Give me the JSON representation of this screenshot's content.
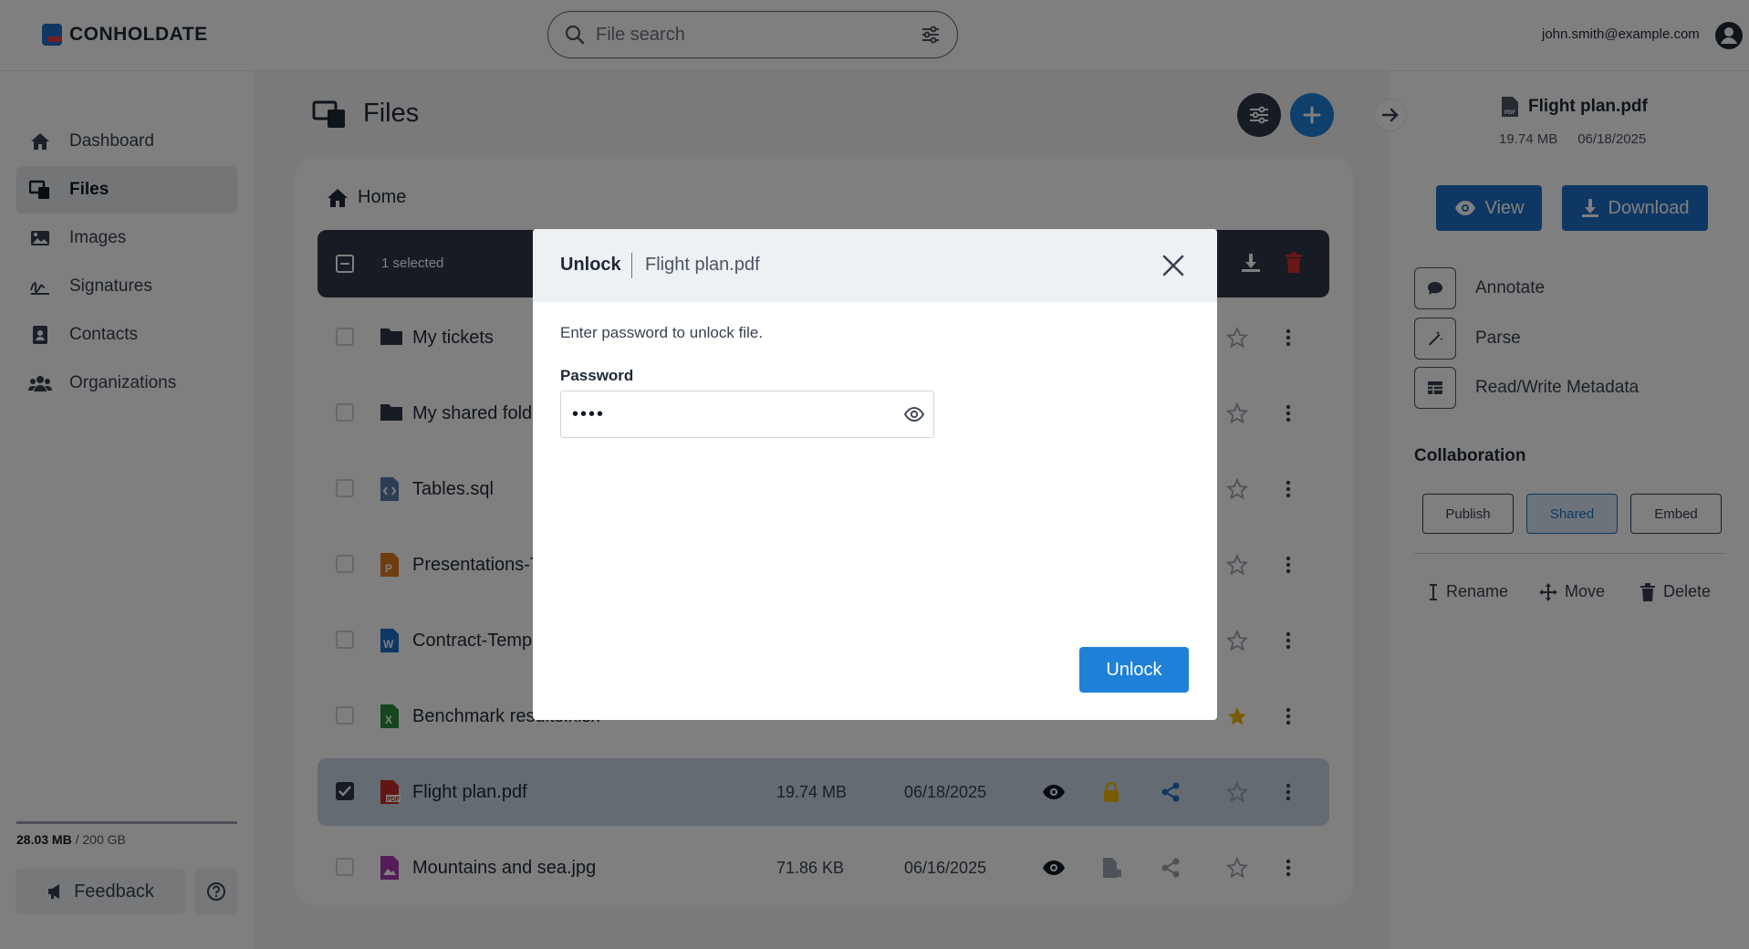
{
  "brand": {
    "name": "CONHOLDATE"
  },
  "header": {
    "search_placeholder": "File search",
    "user_email": "john.smith@example.com"
  },
  "sidebar": {
    "items": [
      {
        "label": "Dashboard",
        "icon": "home-icon"
      },
      {
        "label": "Files",
        "icon": "files-icon",
        "active": true
      },
      {
        "label": "Images",
        "icon": "image-icon"
      },
      {
        "label": "Signatures",
        "icon": "signature-icon"
      },
      {
        "label": "Contacts",
        "icon": "contacts-icon"
      },
      {
        "label": "Organizations",
        "icon": "organizations-icon"
      }
    ],
    "storage_used": "28.03 MB",
    "storage_total": " / 200 GB",
    "feedback_label": "Feedback"
  },
  "main": {
    "title": "Files",
    "breadcrumb": "Home",
    "selection_text": "1 selected",
    "files": [
      {
        "name": "My tickets",
        "type": "folder",
        "size": "",
        "date": ""
      },
      {
        "name": "My shared fold",
        "type": "folder",
        "size": "",
        "date": ""
      },
      {
        "name": "Tables.sql",
        "type": "code",
        "size": "",
        "date": ""
      },
      {
        "name": "Presentations-T",
        "type": "ppt",
        "size": "",
        "date": ""
      },
      {
        "name": "Contract-Temp",
        "type": "word",
        "size": "",
        "date": ""
      },
      {
        "name": "Benchmark results.xlsx",
        "type": "excel",
        "size": "",
        "date": "",
        "starred": true
      },
      {
        "name": "Flight plan.pdf",
        "type": "pdf",
        "size": "19.74 MB",
        "date": "06/18/2025",
        "selected": true,
        "locked": true,
        "shared": true
      },
      {
        "name": "Mountains and sea.jpg",
        "type": "image",
        "size": "71.86 KB",
        "date": "06/16/2025"
      }
    ]
  },
  "details": {
    "file_name": "Flight plan.pdf",
    "file_size": "19.74 MB",
    "file_date": "06/18/2025",
    "view_label": "View",
    "download_label": "Download",
    "actions": [
      "Annotate",
      "Parse",
      "Read/Write Metadata"
    ],
    "collaboration_title": "Collaboration",
    "collab_buttons": [
      "Publish",
      "Shared",
      "Embed"
    ],
    "rename_label": "Rename",
    "move_label": "Move",
    "delete_label": "Delete"
  },
  "modal": {
    "title": "Unlock",
    "file_name": "Flight plan.pdf",
    "message": "Enter password to unlock file.",
    "password_label": "Password",
    "password_value": "••••",
    "unlock_label": "Unlock"
  },
  "colors": {
    "accent": "#1e80d6",
    "dark": "#2d3748",
    "star": "#f2b705",
    "lock": "#f2b705",
    "danger": "#d32f2f"
  }
}
